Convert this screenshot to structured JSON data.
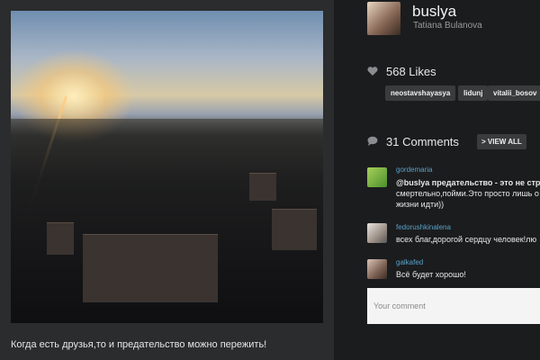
{
  "post": {
    "caption": "Когда есть друзья,то и предательство можно пережить!"
  },
  "profile": {
    "username": "buslya",
    "full_name": "Tatiana Bulanova"
  },
  "likes": {
    "label": "568 Likes",
    "tags": [
      "neostavshayasya",
      "lidunj",
      "vitalii_bosov"
    ]
  },
  "comments": {
    "count_label": "31 Comments",
    "view_all_label": "> VIEW ALL",
    "items": [
      {
        "user": "gordemaria",
        "line1": "@buslya предательство - это не стра",
        "line2": "смертельно,пойми.Это просто лишь о",
        "line3": "жизни идти))"
      },
      {
        "user": "fedorushkinalena",
        "line1": "всех благ,дорогой сердцу человек!лю"
      },
      {
        "user": "galkafed",
        "line1": "Всё будет хорошо!"
      }
    ]
  },
  "comment_input": {
    "placeholder": "Your comment"
  },
  "colors": {
    "username_link": "#5aa1c7",
    "background": "#1b1c1e",
    "panel": "#2b2c2e"
  },
  "icons": {
    "likes": "heart-icon",
    "comments": "speech-bubble-icon"
  }
}
